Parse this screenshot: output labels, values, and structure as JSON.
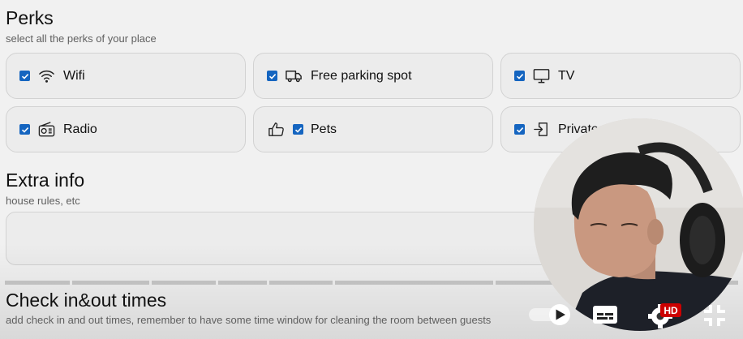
{
  "perks_section": {
    "title": "Perks",
    "subtitle": "select all the perks of your place",
    "items": [
      {
        "label": "Wifi",
        "icon": "wifi-icon",
        "checked": true
      },
      {
        "label": "Free parking spot",
        "icon": "truck-icon",
        "checked": true
      },
      {
        "label": "TV",
        "icon": "tv-icon",
        "checked": true
      },
      {
        "label": "Radio",
        "icon": "radio-icon",
        "checked": true
      },
      {
        "label": "Pets",
        "icon": "thumbs-up-icon",
        "checked": true
      },
      {
        "label": "Private e",
        "icon": "door-entrance-icon",
        "checked": true
      }
    ]
  },
  "extra_info": {
    "title": "Extra info",
    "subtitle": "house rules, etc"
  },
  "check_times": {
    "title": "Check in&out times",
    "subtitle": "add check in and out times, remember to have some time window for cleaning the room between guests"
  },
  "video_player": {
    "hd_badge": "HD",
    "controls": [
      "autoplay-toggle-icon",
      "subtitles-icon",
      "settings-icon",
      "exit-fullscreen-icon"
    ]
  },
  "colors": {
    "checkbox": "#1565c0",
    "hd_badge": "#cc0000",
    "card_border": "#d2d2d2"
  }
}
